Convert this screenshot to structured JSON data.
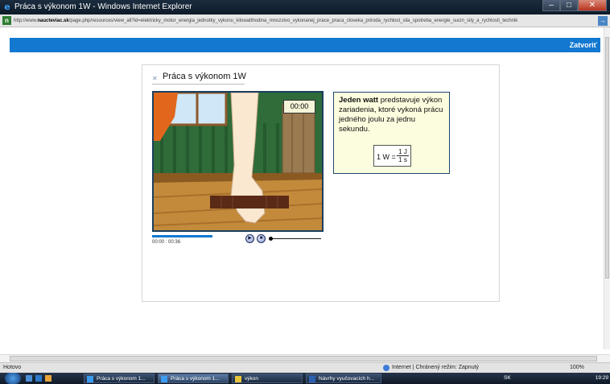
{
  "window": {
    "title": "Práca s výkonom 1W - Windows Internet Explorer",
    "min_glyph": "‒",
    "max_glyph": "□",
    "close_glyph": "✕"
  },
  "address": {
    "url_prefix": "http://www.",
    "url_domain": "naucteviac.sk",
    "url_rest": "/page.php/resources/view_all?id=elektricky_motor_energia_jednotky_vykonu_kilowatthodina_mnozstvo_vykonanej_prace_praca_cloveka_priroda_rychlost_sila_spotreba_energie_sucin_sily_a_rychlosti_technik"
  },
  "page": {
    "close_label": "Zatvoriť"
  },
  "panel": {
    "title": "Práca s výkonom 1W",
    "timer": "00:00",
    "info_bold": "Jeden watt",
    "info_text": " predstavuje výkon zariadenia, ktoré vykoná prácu jedného joulu za jednu sekundu.",
    "formula_lhs": "1 W =",
    "formula_num": "1 J",
    "formula_den": "1 s",
    "time_current": "00:00",
    "time_total": "00:36",
    "progress_fraction": 0.35
  },
  "statusbar": {
    "status": "Hotovo",
    "zone": "Internet | Chránený režim: Zapnutý",
    "zoom": "100%"
  },
  "taskbar": {
    "items": [
      "Práca s výkonom 1...",
      "Práca s výkonom 1...",
      "výkon",
      "Návrhy vyučovacích h..."
    ],
    "lang": "SK",
    "clock": "19:29"
  },
  "colors": {
    "accent": "#1278d0",
    "title_bar": "#1b2c3f",
    "info_box": "#fcfcde"
  }
}
